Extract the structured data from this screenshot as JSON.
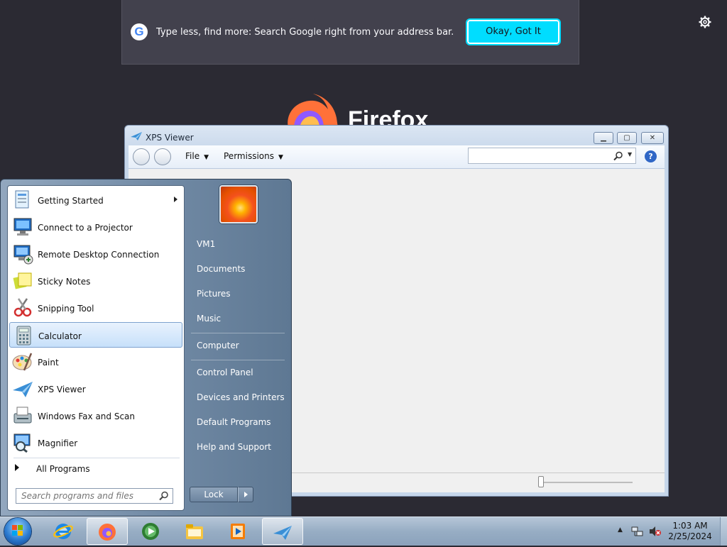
{
  "firefox": {
    "banner_text": "Type less, find more: Search Google right from your address bar.",
    "banner_button": "Okay, Got It",
    "wordmark": "Firefox"
  },
  "xps_viewer": {
    "title": "XPS Viewer",
    "menus": [
      "File",
      "Permissions"
    ],
    "search_placeholder": ""
  },
  "start_menu": {
    "programs": [
      {
        "label": "Getting Started",
        "icon": "getting-started-icon",
        "submenu": true
      },
      {
        "label": "Connect to a Projector",
        "icon": "projector-icon"
      },
      {
        "label": "Remote Desktop Connection",
        "icon": "remote-desktop-icon"
      },
      {
        "label": "Sticky Notes",
        "icon": "sticky-notes-icon"
      },
      {
        "label": "Snipping Tool",
        "icon": "snipping-tool-icon"
      },
      {
        "label": "Calculator",
        "icon": "calculator-icon",
        "selected": true
      },
      {
        "label": "Paint",
        "icon": "paint-icon"
      },
      {
        "label": "XPS Viewer",
        "icon": "xps-viewer-icon"
      },
      {
        "label": "Windows Fax and Scan",
        "icon": "fax-scan-icon"
      },
      {
        "label": "Magnifier",
        "icon": "magnifier-icon"
      }
    ],
    "all_programs": "All Programs",
    "search_placeholder": "Search programs and files",
    "right_items": [
      "VM1",
      "Documents",
      "Pictures",
      "Music",
      "Computer",
      "Control Panel",
      "Devices and Printers",
      "Default Programs",
      "Help and Support"
    ],
    "lock_label": "Lock"
  },
  "taskbar": {
    "pinned": [
      "internet-explorer-icon",
      "firefox-icon",
      "media-center-icon",
      "explorer-folder-icon",
      "media-player-icon",
      "xps-viewer-icon"
    ],
    "time": "1:03 AM",
    "date": "2/25/2024"
  }
}
